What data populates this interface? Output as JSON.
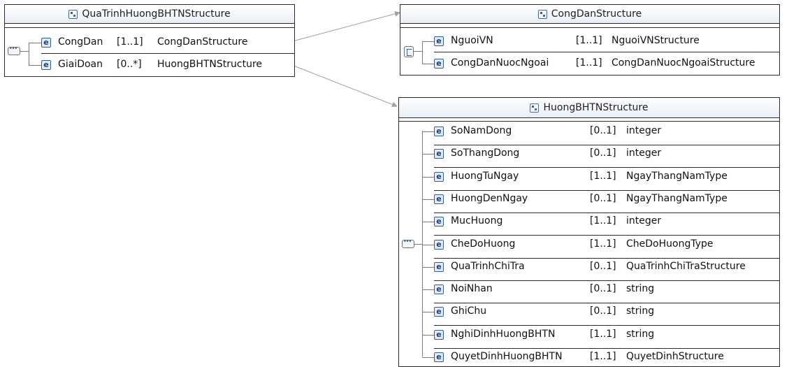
{
  "boxes": {
    "qua_trinh": {
      "title": "QuaTrinhHuongBHTNStructure",
      "rows": [
        {
          "name": "CongDan",
          "card": "[1..1]",
          "type": "CongDanStructure"
        },
        {
          "name": "GiaiDoan",
          "card": "[0..*]",
          "type": "HuongBHTNStructure"
        }
      ]
    },
    "cong_dan": {
      "title": "CongDanStructure",
      "rows": [
        {
          "name": "NguoiVN",
          "card": "[1..1]",
          "type": "NguoiVNStructure"
        },
        {
          "name": "CongDanNuocNgoai",
          "card": "[1..1]",
          "type": "CongDanNuocNgoaiStructure"
        }
      ]
    },
    "huong": {
      "title": "HuongBHTNStructure",
      "rows": [
        {
          "name": "SoNamDong",
          "card": "[0..1]",
          "type": "integer"
        },
        {
          "name": "SoThangDong",
          "card": "[0..1]",
          "type": "integer"
        },
        {
          "name": "HuongTuNgay",
          "card": "[1..1]",
          "type": "NgayThangNamType"
        },
        {
          "name": "HuongDenNgay",
          "card": "[0..1]",
          "type": "NgayThangNamType"
        },
        {
          "name": "MucHuong",
          "card": "[1..1]",
          "type": "integer"
        },
        {
          "name": "CheDoHuong",
          "card": "[1..1]",
          "type": "CheDoHuongType"
        },
        {
          "name": "QuaTrinhChiTra",
          "card": "[0..1]",
          "type": "QuaTrinhChiTraStructure"
        },
        {
          "name": "NoiNhan",
          "card": "[0..1]",
          "type": "string"
        },
        {
          "name": "GhiChu",
          "card": "[0..1]",
          "type": "string"
        },
        {
          "name": "NghiDinhHuongBHTN",
          "card": "[1..1]",
          "type": "string"
        },
        {
          "name": "QuyetDinhHuongBHTN",
          "card": "[1..1]",
          "type": "QuyetDinhStructure"
        }
      ]
    }
  },
  "icons": {
    "element_glyph": "e",
    "structure_icon": "structure-icon",
    "sequence_icon": "sequence-icon",
    "choice_icon": "choice-icon"
  },
  "colors": {
    "border": "#2b2b2b",
    "icon_blue": "#2f5f9e",
    "connector": "#a0a0a0"
  }
}
